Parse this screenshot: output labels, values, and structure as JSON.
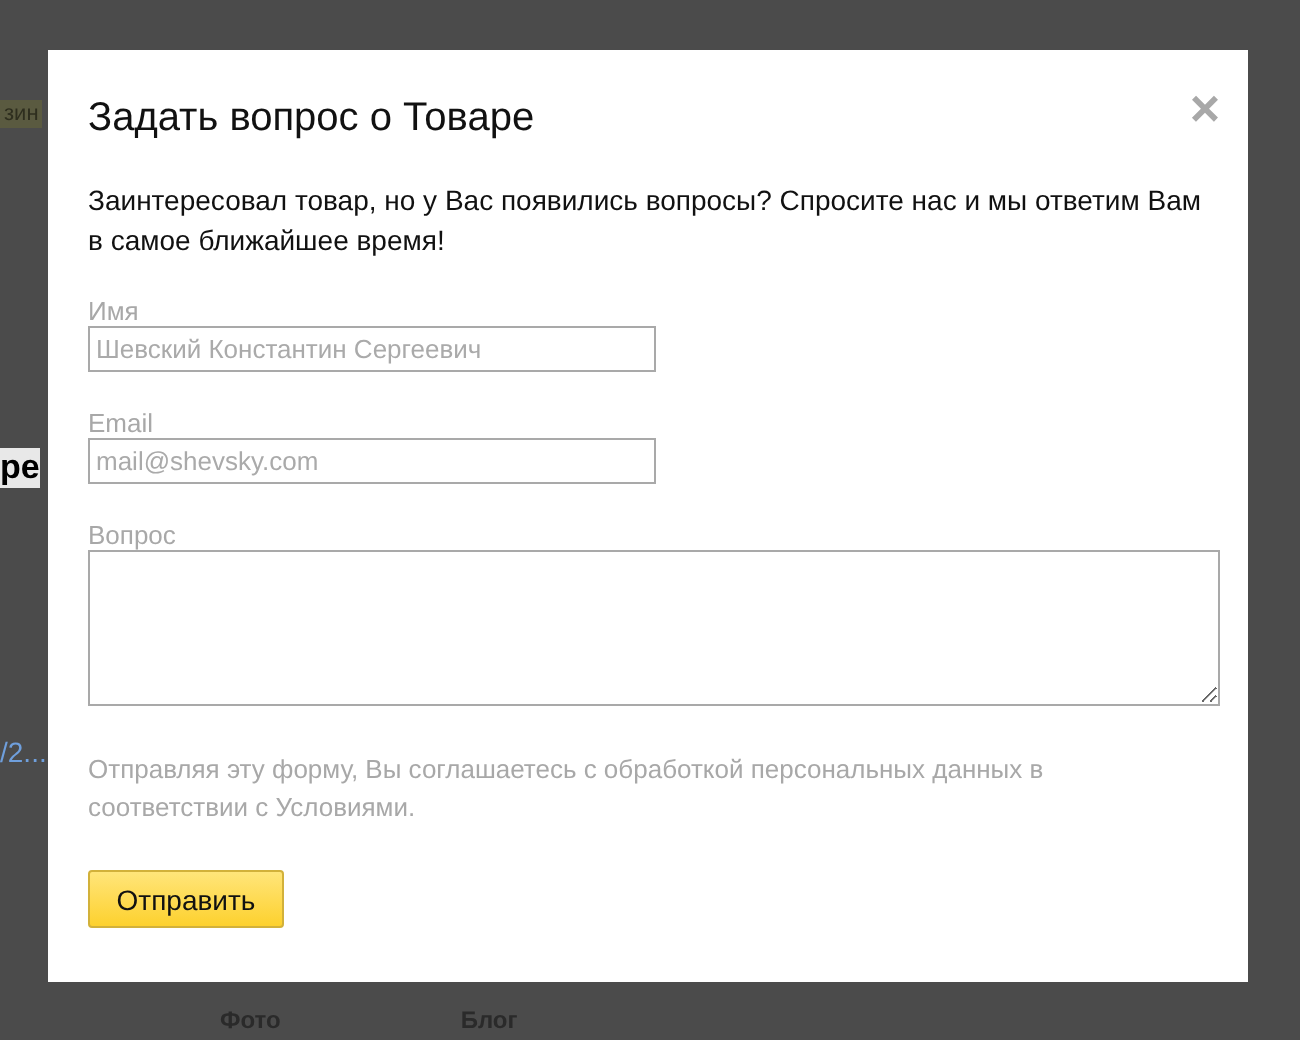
{
  "background_page": {
    "tag": "зин",
    "heading": "ре",
    "link": "/2...",
    "footer_links": [
      "Фото",
      "Блог"
    ]
  },
  "dialog": {
    "title": "Задать вопрос о Товаре",
    "close": "×",
    "intro": "Заинтересовал товар, но у Вас появились вопросы? Спросите нас и мы ответим Вам в самое ближайшее время!",
    "fields": [
      {
        "kind": "input",
        "label": "Имя",
        "placeholder": "Шевский Константин Сергеевич"
      },
      {
        "kind": "input",
        "label": "Email",
        "placeholder": "mail@shevsky.com"
      },
      {
        "kind": "textarea",
        "label": "Вопрос"
      }
    ],
    "notice": "Отправляя эту форму, Вы соглашаетесь с обработкой персональных данных в соответствии с Условиями.",
    "submit": "Отправить"
  }
}
